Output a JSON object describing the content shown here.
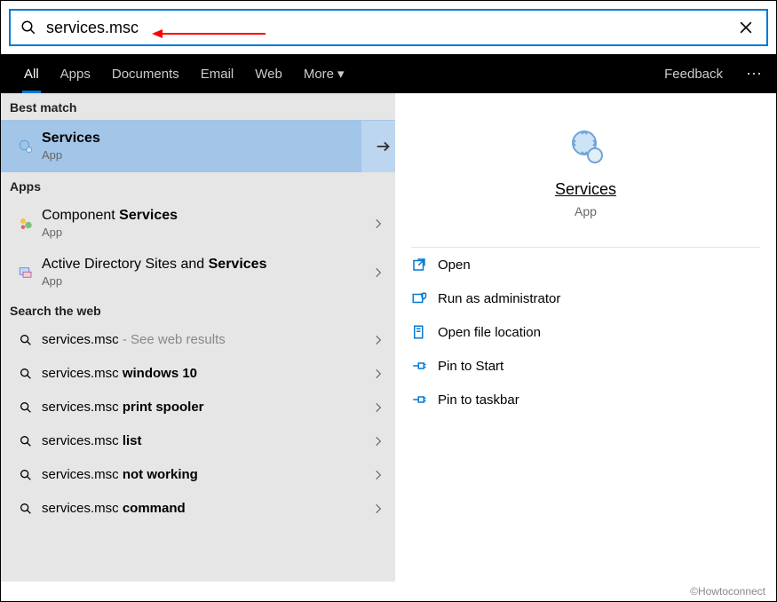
{
  "search": {
    "value": "services.msc"
  },
  "tabs": {
    "items": [
      "All",
      "Apps",
      "Documents",
      "Email",
      "Web",
      "More"
    ],
    "feedback": "Feedback"
  },
  "sections": {
    "best": "Best match",
    "apps": "Apps",
    "web": "Search the web"
  },
  "best": {
    "title": "Services",
    "sub": "App"
  },
  "apps": [
    {
      "pre": "Component ",
      "bold": "Services",
      "post": "",
      "sub": "App"
    },
    {
      "pre": "Active Directory Sites and ",
      "bold": "Services",
      "post": "",
      "sub": "App"
    }
  ],
  "web": [
    {
      "pre": "services.msc",
      "bold": "",
      "post": "",
      "hint": " - See web results"
    },
    {
      "pre": "services.msc ",
      "bold": "windows 10",
      "post": "",
      "hint": ""
    },
    {
      "pre": "services.msc ",
      "bold": "print spooler",
      "post": "",
      "hint": ""
    },
    {
      "pre": "services.msc ",
      "bold": "list",
      "post": "",
      "hint": ""
    },
    {
      "pre": "services.msc ",
      "bold": "not working",
      "post": "",
      "hint": ""
    },
    {
      "pre": "services.msc ",
      "bold": "command",
      "post": "",
      "hint": ""
    }
  ],
  "detail": {
    "title": "Services",
    "sub": "App",
    "actions": [
      "Open",
      "Run as administrator",
      "Open file location",
      "Pin to Start",
      "Pin to taskbar"
    ]
  },
  "footer": "©Howtoconnect"
}
